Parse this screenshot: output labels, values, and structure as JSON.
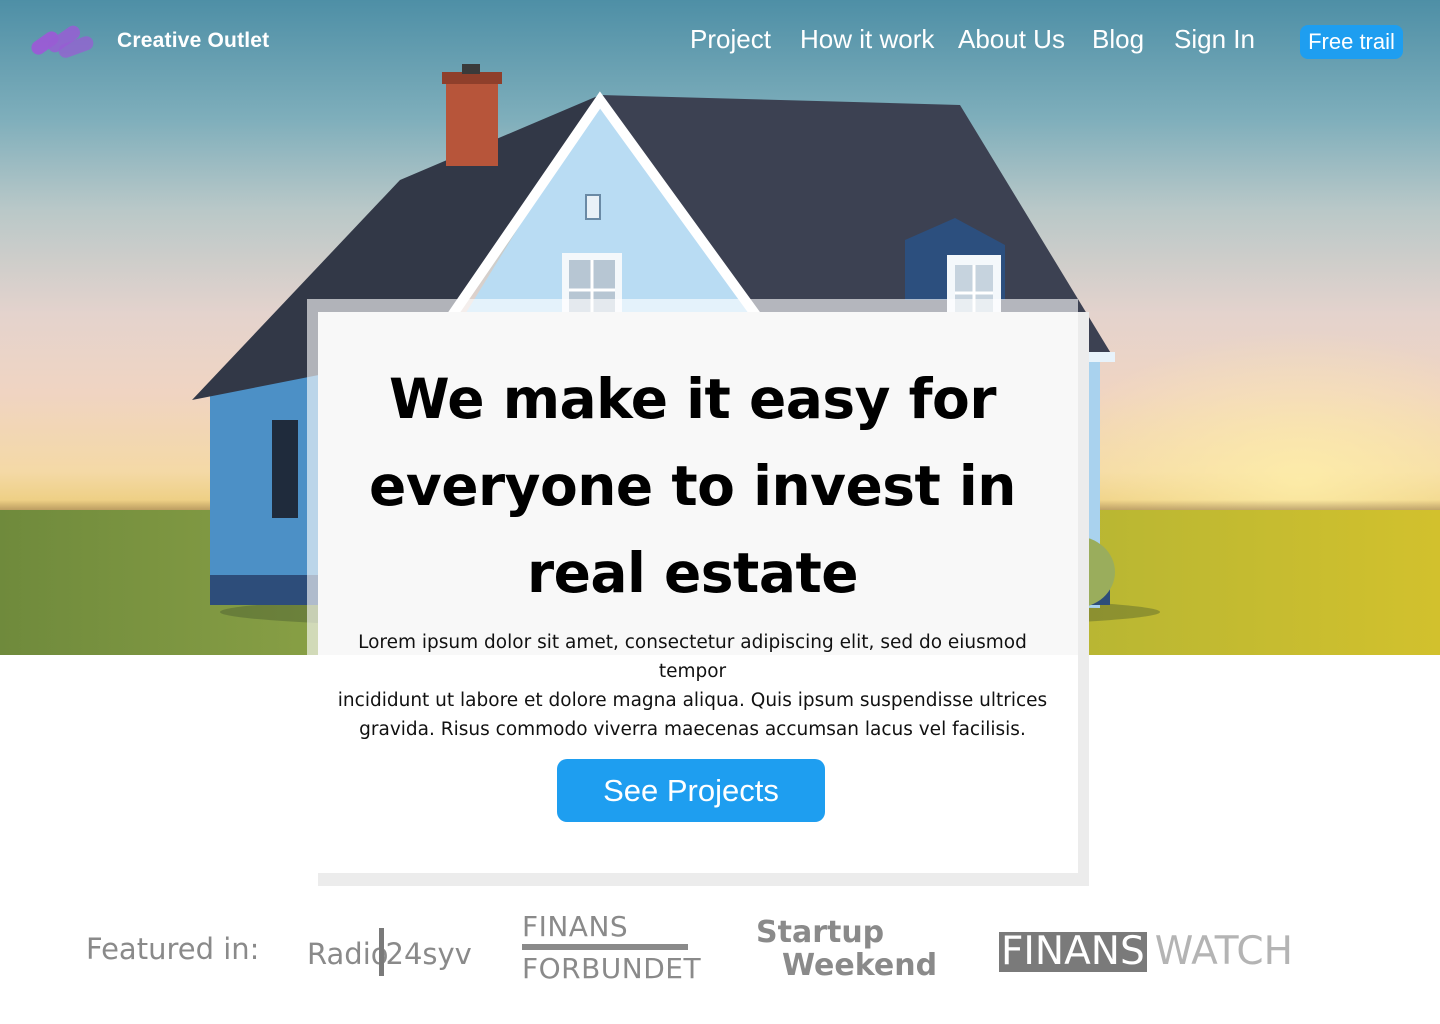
{
  "brand": {
    "name": "Creative Outlet",
    "logo_icon": "stripes-logo-icon",
    "logo_color": "#9b5bd6"
  },
  "nav": {
    "links": [
      "Project",
      "How it work",
      "About Us",
      "Blog",
      "Sign In"
    ],
    "cta_label": "Free trail"
  },
  "hero": {
    "image": "house-illustration",
    "headline_lines": [
      "We make it easy for",
      "everyone to invest in",
      "real estate"
    ],
    "subtext_lines": [
      "Lorem ipsum dolor sit amet, consectetur adipiscing elit, sed do eiusmod tempor",
      "incididunt ut labore et dolore magna aliqua. Quis ipsum suspendisse ultrices",
      "gravida. Risus commodo viverra maecenas accumsan lacus vel facilisis."
    ],
    "button_label": "See Projects"
  },
  "featured": {
    "label": "Featured in:",
    "radio": {
      "left": "Radio",
      "right": "24syv"
    },
    "finans_forbundet": {
      "top": "FINANS",
      "bottom": "FORBUNDET"
    },
    "startup": {
      "line1": "Startup",
      "line2": "Weekend"
    },
    "finanswatch": {
      "dark": "FINANS",
      "light": "WATCH"
    }
  },
  "colors": {
    "accent": "#1e9ef0",
    "logo_purple": "#9b5bd6",
    "roof": "#3b4252",
    "walls": "#9ecbe8",
    "chimney": "#b7553a",
    "muted_text": "#8a8a8a"
  }
}
